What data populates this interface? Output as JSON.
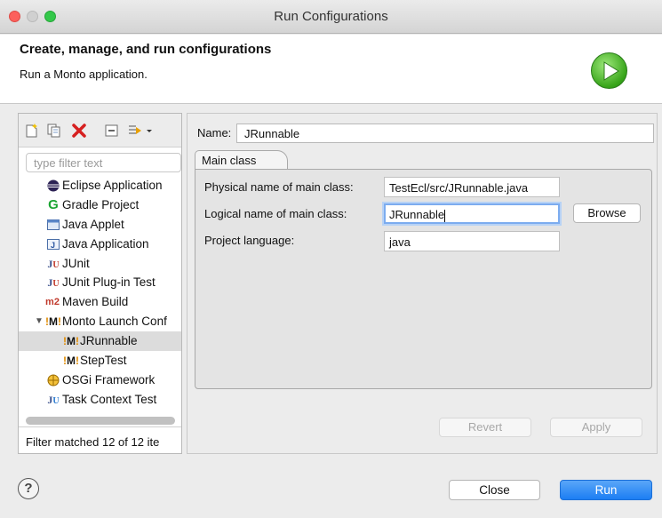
{
  "window": {
    "title": "Run Configurations"
  },
  "header": {
    "title": "Create, manage, and run configurations",
    "message": "Run a Monto application."
  },
  "left": {
    "toolbar_icons": [
      "new-configuration-icon",
      "duplicate-icon",
      "delete-icon",
      "collapse-all-icon",
      "filter-menu-icon"
    ],
    "filter_placeholder": "type filter text",
    "tree": [
      {
        "label": "Eclipse Application",
        "icon": "eclipse-icon"
      },
      {
        "label": "Gradle Project",
        "icon": "gradle-icon"
      },
      {
        "label": "Java Applet",
        "icon": "java-applet-icon"
      },
      {
        "label": "Java Application",
        "icon": "java-application-icon"
      },
      {
        "label": "JUnit",
        "icon": "junit-icon"
      },
      {
        "label": "JUnit Plug-in Test",
        "icon": "junit-plugin-icon"
      },
      {
        "label": "Maven Build",
        "icon": "maven-icon"
      },
      {
        "label": "Monto Launch Conf",
        "icon": "monto-icon"
      },
      {
        "label": "JRunnable",
        "icon": "monto-icon"
      },
      {
        "label": "StepTest",
        "icon": "monto-icon"
      },
      {
        "label": "OSGi Framework",
        "icon": "osgi-icon"
      },
      {
        "label": "Task Context Test",
        "icon": "task-context-icon"
      }
    ],
    "status": "Filter matched 12 of 12 ite"
  },
  "right": {
    "name_label": "Name:",
    "name_value": "JRunnable",
    "tab_label": "Main class",
    "fields": {
      "physical_label": "Physical name of main class:",
      "physical_value": "TestEcl/src/JRunnable.java",
      "logical_label": "Logical name of main class:",
      "logical_value": "JRunnable",
      "language_label": "Project language:",
      "language_value": "java"
    },
    "browse_label": "Browse",
    "revert_label": "Revert",
    "apply_label": "Apply"
  },
  "footer": {
    "help_label": "?",
    "close_label": "Close",
    "run_label": "Run"
  },
  "colors": {
    "accent": "#1c7ef3",
    "run_green": "#37a419",
    "selection": "#dcdcdc"
  }
}
